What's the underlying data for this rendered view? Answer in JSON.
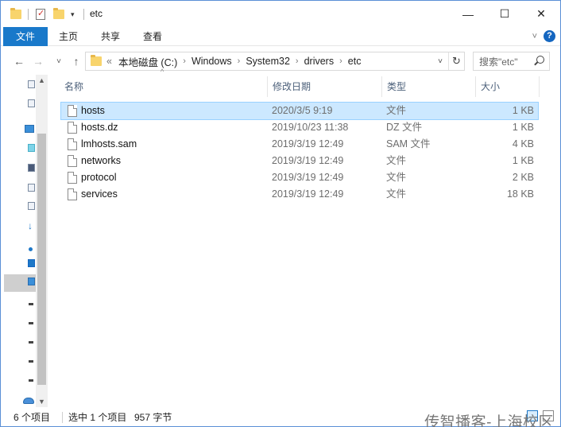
{
  "window": {
    "title": "etc",
    "minimize_label": "—",
    "maximize_label": "☐",
    "close_label": "✕",
    "qa_dropdown": "▾"
  },
  "ribbon": {
    "tabs": [
      "文件",
      "主页",
      "共享",
      "查看"
    ],
    "expand_label": "˅",
    "help_label": "?"
  },
  "nav": {
    "back": "←",
    "forward": "→",
    "recent": "˅",
    "up": "↑",
    "overflow": "«",
    "breadcrumbs": [
      "本地磁盘 (C:)",
      "Windows",
      "System32",
      "drivers",
      "etc"
    ],
    "crumb_separator": "›",
    "dropdown": "˅",
    "refresh": "↻",
    "search_placeholder": "搜索\"etc\""
  },
  "columns": {
    "name": "名称",
    "date": "修改日期",
    "type": "类型",
    "size": "大小",
    "sort_indicator": "^"
  },
  "files": [
    {
      "name": "hosts",
      "date": "2020/3/5 9:19",
      "type": "文件",
      "size": "1 KB",
      "selected": true
    },
    {
      "name": "hosts.dz",
      "date": "2019/10/23 11:38",
      "type": "DZ 文件",
      "size": "1 KB",
      "selected": false
    },
    {
      "name": "lmhosts.sam",
      "date": "2019/3/19 12:49",
      "type": "SAM 文件",
      "size": "4 KB",
      "selected": false
    },
    {
      "name": "networks",
      "date": "2019/3/19 12:49",
      "type": "文件",
      "size": "1 KB",
      "selected": false
    },
    {
      "name": "protocol",
      "date": "2019/3/19 12:49",
      "type": "文件",
      "size": "2 KB",
      "selected": false
    },
    {
      "name": "services",
      "date": "2019/3/19 12:49",
      "type": "文件",
      "size": "18 KB",
      "selected": false
    }
  ],
  "status": {
    "item_count": "6 个项目",
    "selection": "选中 1 个项目",
    "selection_size": "957 字节",
    "watermark": "传智播客-上海校区"
  },
  "colors": {
    "file_tab": "#1979ca",
    "selected_row": "#cce8ff",
    "help": "#1466c0"
  }
}
